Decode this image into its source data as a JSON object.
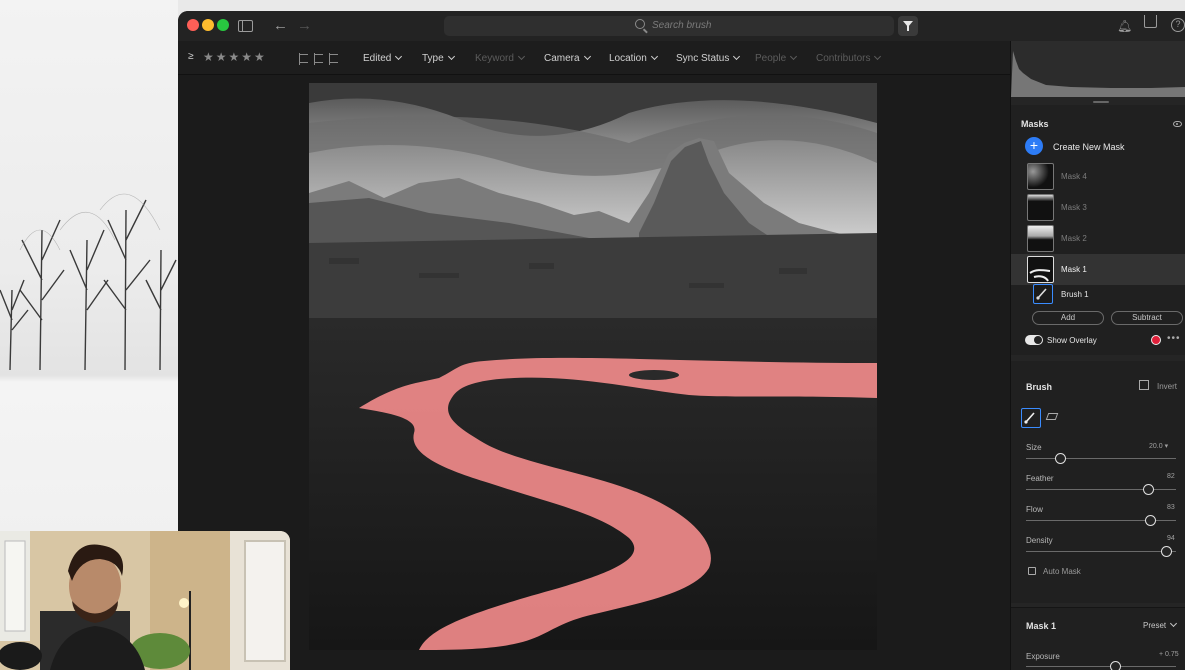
{
  "search": {
    "placeholder": "Search brush"
  },
  "filterbar": {
    "rating_prefix": "≥",
    "stars": "★★★★★",
    "filters": [
      {
        "label": "Edited",
        "enabled": true
      },
      {
        "label": "Type",
        "enabled": true
      },
      {
        "label": "Keyword",
        "enabled": false
      },
      {
        "label": "Camera",
        "enabled": true
      },
      {
        "label": "Location",
        "enabled": true
      },
      {
        "label": "Sync Status",
        "enabled": true
      },
      {
        "label": "People",
        "enabled": false
      },
      {
        "label": "Contributors",
        "enabled": false
      }
    ]
  },
  "masks": {
    "title": "Masks",
    "create_label": "Create New Mask",
    "items": [
      {
        "label": "Mask 4",
        "active": false
      },
      {
        "label": "Mask 3",
        "active": false
      },
      {
        "label": "Mask 2",
        "active": false
      },
      {
        "label": "Mask 1",
        "active": true
      }
    ],
    "component_label": "Brush 1",
    "add_label": "Add",
    "subtract_label": "Subtract",
    "overlay_label": "Show Overlay",
    "overlay_color": "#e0203a"
  },
  "brush": {
    "title": "Brush",
    "invert_label": "Invert",
    "size": {
      "label": "Size",
      "value": "20.0",
      "level": 0.23
    },
    "feather": {
      "label": "Feather",
      "value": "82",
      "level": 0.82
    },
    "flow": {
      "label": "Flow",
      "value": "83",
      "level": 0.83
    },
    "density": {
      "label": "Density",
      "value": "94",
      "level": 0.94
    },
    "auto_mask_label": "Auto Mask"
  },
  "mask_adjust": {
    "title": "Mask 1",
    "preset_label": "Preset",
    "exposure": {
      "label": "Exposure",
      "value": "+ 0.75",
      "level": 0.6
    }
  },
  "colors": {
    "accent": "#2d7cf6",
    "overlay": "#f08a8a"
  }
}
